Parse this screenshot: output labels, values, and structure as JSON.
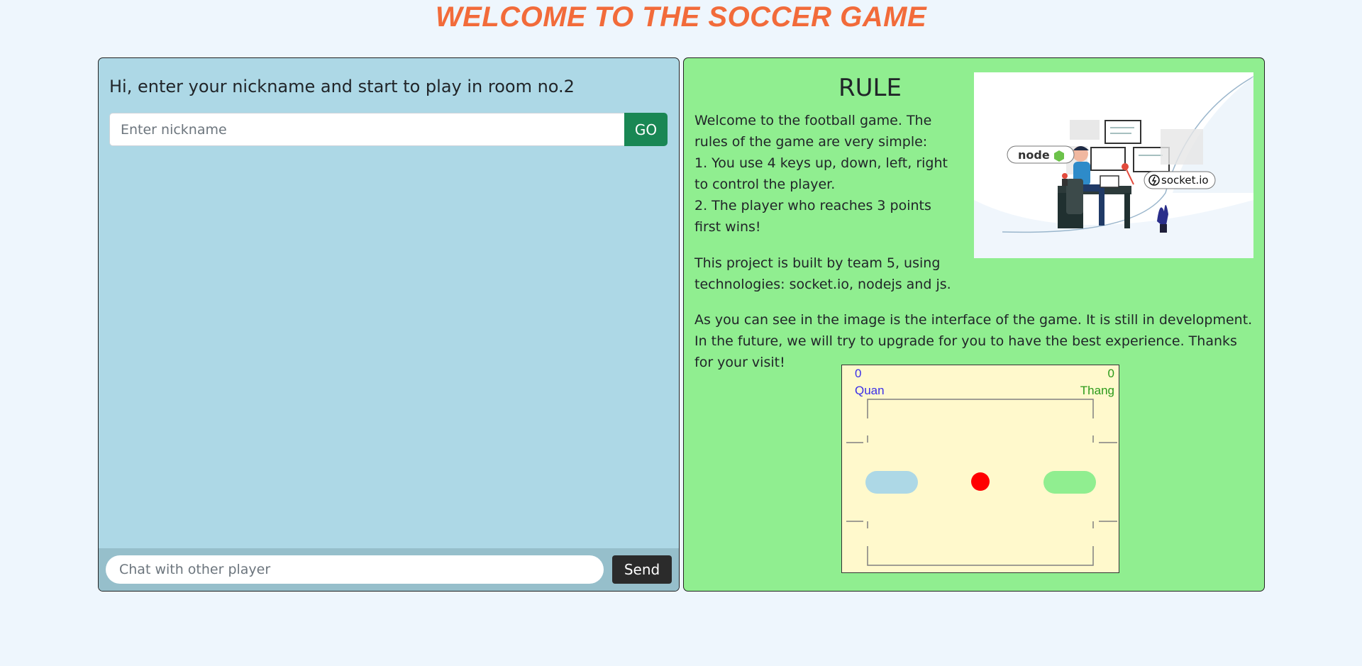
{
  "page": {
    "title": "WELCOME TO THE SOCCER GAME"
  },
  "lobby": {
    "greeting": "Hi, enter your nickname and start to play in room no.2",
    "nickname_placeholder": "Enter nickname",
    "nickname_value": "",
    "go_label": "GO"
  },
  "chat": {
    "placeholder": "Chat with other player",
    "value": "",
    "send_label": "Send"
  },
  "rules": {
    "title": "RULE",
    "intro": "Welcome to the football game. The rules of the game are very simple:",
    "rule1": "1. You use 4 keys up, down, left, right to control the player.",
    "rule2": "2. The player who reaches 3 points first wins!",
    "project": "This project is built by team 5, using technologies: socket.io, nodejs and js.",
    "interface": "As you can see in the image is the interface of the game. It is still in development. In the future, we will try to upgrade for you to have the best experience. Thanks for your visit!"
  },
  "hero_image": {
    "logo_node": "node",
    "logo_socket": "socket.io"
  },
  "game_preview": {
    "player1": {
      "name": "Quan",
      "score": "0",
      "color": "#3a2ee8"
    },
    "player2": {
      "name": "Thang",
      "score": "0",
      "color": "#2a9a1a"
    },
    "ball_color": "#ff0000",
    "paddle1_color": "#add8e6",
    "paddle2_color": "#90ee90"
  },
  "colors": {
    "title": "#f26b3a",
    "go_button": "#198754",
    "send_button": "#2b2b2b",
    "left_panel": "#add8e6",
    "right_panel": "#90ee90"
  }
}
